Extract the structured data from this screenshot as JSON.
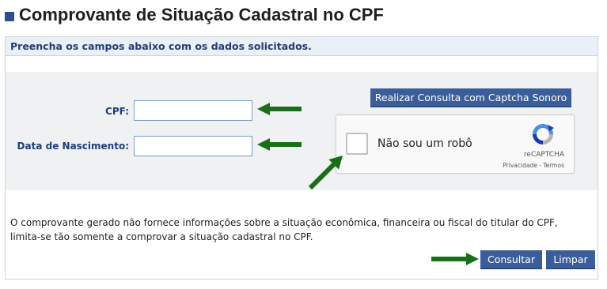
{
  "page": {
    "title": "Comprovante de Situação Cadastral no CPF"
  },
  "form": {
    "instructions": "Preencha os campos abaixo com os dados solicitados.",
    "cpf_label": "CPF:",
    "cpf_value": "",
    "birth_label": "Data de Nascimento:",
    "birth_value": "",
    "audio_captcha_button": "Realizar Consulta com Captcha Sonoro"
  },
  "recaptcha": {
    "label": "Não sou um robô",
    "brand": "reCAPTCHA",
    "privacy_link": "Privacidade",
    "separator": " - ",
    "terms_link": "Termos",
    "icon": "recaptcha-logo-icon"
  },
  "disclaimer": "O comprovante gerado não fornece informações sobre a situação econômica, financeira ou fiscal do titular do CPF, limita-se tão somente a comprovar a situação cadastral no CPF.",
  "actions": {
    "submit": "Consultar",
    "clear": "Limpar"
  },
  "annotations": {
    "arrow_color": "#1a6e1a",
    "icon": "arrow-icon"
  },
  "colors": {
    "accent": "#3b5e9b",
    "label": "#1f3d7a",
    "header_bg": "#eaf0f7"
  }
}
